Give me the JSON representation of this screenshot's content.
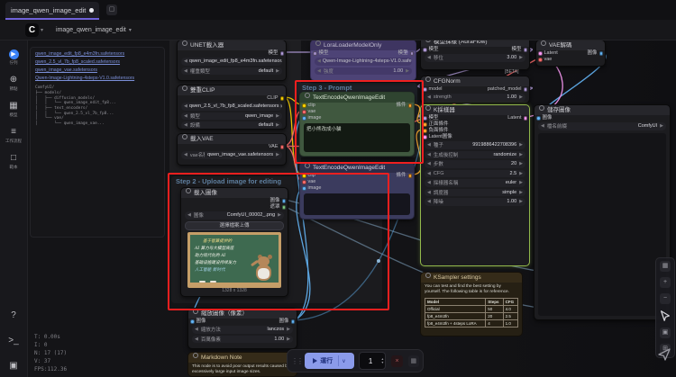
{
  "app": {
    "tab_title": "image_qwen_image_edit",
    "workflow_title": "image_qwen_image_edit",
    "logo": "C"
  },
  "sidebar": {
    "items": [
      {
        "id": "queue",
        "label": "佇列",
        "icon": "queue-icon"
      },
      {
        "id": "nodes",
        "label": "節點",
        "icon": "node-library-icon"
      },
      {
        "id": "models",
        "label": "模型",
        "icon": "model-library-icon"
      },
      {
        "id": "workflows",
        "label": "工作流程",
        "icon": "workflows-icon"
      },
      {
        "id": "templates",
        "label": "範本",
        "icon": "templates-icon"
      }
    ],
    "bottom": [
      {
        "id": "help",
        "label": "",
        "icon": "help-icon",
        "glyph": "?"
      },
      {
        "id": "terminal",
        "label": "",
        "icon": "terminal-icon",
        "glyph": ">_"
      },
      {
        "id": "panel",
        "label": "",
        "icon": "bottom-panel-icon",
        "glyph": "▣"
      }
    ]
  },
  "stats": {
    "lines": [
      "T: 0.00s",
      "I: 0",
      "N: 17 (17)",
      "V: 37",
      "FPS:112.36"
    ]
  },
  "links_note": {
    "links": [
      "qwen_image_edit_fp8_e4m3fn.safetensors",
      "qwen_2.5_vl_7b_fp8_scaled.safetensors",
      "qwen_image_vae.safetensors",
      "Qwen-Image-Lightning-4steps-V1.0.safetensors"
    ],
    "tree": [
      "ComfyUI/",
      "├── models/",
      "│   ├── diffusion_models/",
      "│   │   └── qwen_image_edit_fp8...",
      "│   ├── text_encoders/",
      "│   │   └── qwen_2.5_vl_7b_fp8...",
      "│   └── vae/",
      "│       └── qwen_image_vae..."
    ]
  },
  "groups": {
    "step2": "Step 2 - Upload image for editing",
    "step3": "Step 3 - Prompt"
  },
  "beta_badge": "[BETA]",
  "nodes": {
    "unet": {
      "title": "UNET載入器",
      "outputs": [
        {
          "name": "模型",
          "color": "#B39DDB"
        }
      ],
      "widgets": [
        {
          "type": "combo",
          "value": "qwen_image_edit_fp8_e4m3fn.safetensors"
        },
        {
          "type": "row",
          "label": "權重類型",
          "value": "default"
        }
      ]
    },
    "dualclip": {
      "title": "雙重CLIP",
      "outputs": [
        {
          "name": "CLIP",
          "color": "#FFD500"
        }
      ],
      "widgets": [
        {
          "type": "combo",
          "value": "qwen_2.5_vl_7b_fp8_scaled.safetensors"
        },
        {
          "type": "row",
          "label": "類型",
          "value": "qwen_image"
        },
        {
          "type": "row",
          "label": "設備",
          "value": "default"
        }
      ]
    },
    "vaeloader": {
      "title": "載入VAE",
      "outputs": [
        {
          "name": "VAE",
          "color": "#FF6E6E"
        }
      ],
      "widgets": [
        {
          "type": "row",
          "label": "vae名稱",
          "value": "qwen_image_vae.safetensors"
        }
      ]
    },
    "lora": {
      "title": "LoraLoaderModelOnly",
      "inputs": [
        {
          "name": "模型",
          "color": "#B39DDB"
        }
      ],
      "outputs": [
        {
          "name": "模型",
          "color": "#B39DDB"
        }
      ],
      "widgets": [
        {
          "type": "combo",
          "value": "Qwen-Image-Lightning-4steps-V1.0.safetensors"
        },
        {
          "type": "row",
          "label": "強度",
          "value": "1.00"
        }
      ]
    },
    "te_pos": {
      "title": "TextEncodeQwenImageEdit",
      "inputs": [
        {
          "name": "clip",
          "color": "#FFD500"
        },
        {
          "name": "vae",
          "color": "#FF6E6E"
        },
        {
          "name": "image",
          "color": "#64B5F6"
        }
      ],
      "outputs": [
        {
          "name": "條件",
          "color": "#FFA931"
        }
      ],
      "widgets": [
        {
          "type": "textarea",
          "value": "把小熊改成小貓"
        }
      ]
    },
    "te_neg": {
      "title": "TextEncodeQwenImageEdit",
      "inputs": [
        {
          "name": "clip",
          "color": "#FFD500"
        },
        {
          "name": "vae",
          "color": "#FF6E6E"
        },
        {
          "name": "image",
          "color": "#64B5F6"
        }
      ],
      "outputs": [
        {
          "name": "條件",
          "color": "#FFA931"
        }
      ],
      "widgets": [
        {
          "type": "textarea",
          "value": ""
        }
      ]
    },
    "loadimage": {
      "title": "載入圖像",
      "outputs": [
        {
          "name": "圖像",
          "color": "#64B5F6"
        },
        {
          "name": "遮罩",
          "color": "#81C784"
        }
      ],
      "widgets": [
        {
          "type": "row",
          "label": "圖像",
          "value": "ComfyUI_00002_.png"
        },
        {
          "type": "button",
          "value": "選擇檔案上傳"
        },
        {
          "type": "image"
        },
        {
          "type": "caption",
          "value": "1328 x 1328"
        }
      ]
    },
    "scale": {
      "title": "縮放圖像（像素）",
      "inputs": [
        {
          "name": "圖像",
          "color": "#64B5F6"
        }
      ],
      "outputs": [
        {
          "name": "圖像",
          "color": "#64B5F6"
        }
      ],
      "widgets": [
        {
          "type": "row",
          "label": "縮放方法",
          "value": "lanczos"
        },
        {
          "type": "row",
          "label": "百萬像素",
          "value": "1.00"
        }
      ]
    },
    "modelsampling": {
      "title": "模型採樣 (AuraFlow)",
      "inputs": [
        {
          "name": "模型",
          "color": "#B39DDB"
        }
      ],
      "outputs": [
        {
          "name": "模型",
          "color": "#B39DDB"
        }
      ],
      "widgets": [
        {
          "type": "row",
          "label": "移位",
          "value": "3.00"
        }
      ]
    },
    "cfgnorm": {
      "title": "CFGNorm",
      "inputs": [
        {
          "name": "model",
          "color": "#B39DDB"
        }
      ],
      "outputs": [
        {
          "name": "patched_model",
          "color": "#B39DDB"
        }
      ],
      "widgets": [
        {
          "type": "row",
          "label": "strength",
          "value": "1.00"
        }
      ]
    },
    "ksampler": {
      "title": "K採樣器",
      "inputs": [
        {
          "name": "模型",
          "color": "#B39DDB"
        },
        {
          "name": "正面條件",
          "color": "#FFA931"
        },
        {
          "name": "負面條件",
          "color": "#FFA931"
        },
        {
          "name": "Latent圖像",
          "color": "#FF9CF9"
        }
      ],
      "outputs": [
        {
          "name": "Latent",
          "color": "#FF9CF9"
        }
      ],
      "widgets": [
        {
          "type": "row",
          "label": "種子",
          "value": "9919886422708396"
        },
        {
          "type": "row",
          "label": "生成後控制",
          "value": "randomize"
        },
        {
          "type": "row",
          "label": "步數",
          "value": "20"
        },
        {
          "type": "row",
          "label": "CFG",
          "value": "2.5"
        },
        {
          "type": "row",
          "label": "採樣器名稱",
          "value": "euler"
        },
        {
          "type": "row",
          "label": "調度器",
          "value": "simple"
        },
        {
          "type": "row",
          "label": "降噪",
          "value": "1.00"
        },
        {
          "type": "fill"
        }
      ]
    },
    "vaedecode": {
      "title": "VAE解碼",
      "inputs": [
        {
          "name": "Latent",
          "color": "#FF9CF9"
        },
        {
          "name": "vae",
          "color": "#FF6E6E"
        }
      ],
      "outputs": [
        {
          "name": "圖像",
          "color": "#64B5F6"
        }
      ],
      "widgets": []
    },
    "saveimage": {
      "title": "儲存圖像",
      "inputs": [
        {
          "name": "圖像",
          "color": "#64B5F6"
        }
      ],
      "widgets": [
        {
          "type": "row",
          "label": "檔名前綴",
          "value": "ComfyUI"
        },
        {
          "type": "fill"
        }
      ]
    }
  },
  "chalkboard": {
    "lines": [
      {
        "text": "基于智算提供的",
        "color": "#f2dd88"
      },
      {
        "text": "AI 算力与大模型底座",
        "color": "#f3f3ea"
      },
      {
        "text": "助力现代化的 AI",
        "color": "#f3f3ea"
      },
      {
        "text": "基础设施建设持续发力",
        "color": "#f3f3ea"
      },
      {
        "text": "人工智能 新时代",
        "color": "#a8d8f0"
      }
    ]
  },
  "notes": {
    "md": {
      "title": "Markdown Note",
      "body": "This node is to avoid poor output results caused by excessively large input image sizes."
    },
    "ks": {
      "title": "KSampler settings",
      "body": "You can test and find the best setting by yourself. The following table is for reference.",
      "table": {
        "headers": [
          "Model",
          "Steps",
          "CFG"
        ],
        "rows": [
          [
            "Official",
            "50",
            "4.0"
          ],
          [
            "fp8_e4m3fn",
            "20",
            "2.5"
          ],
          [
            "fp8_e4m3fn + 4steps LoRA",
            "4",
            "1.0"
          ]
        ]
      }
    }
  },
  "run_bar": {
    "run_label": "運行",
    "count": "1"
  }
}
